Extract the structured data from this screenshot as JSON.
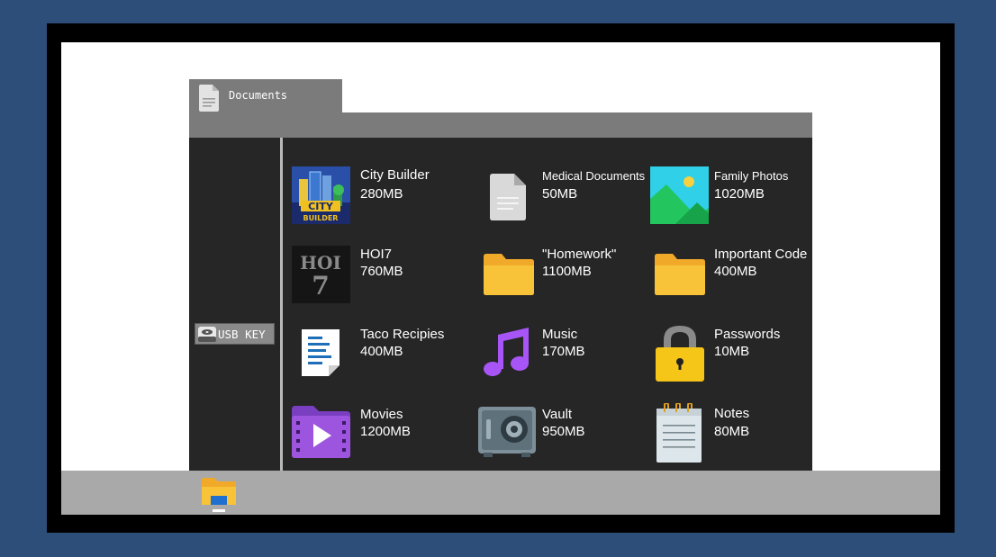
{
  "window": {
    "title": "Documents"
  },
  "sidebar": {
    "usb_label": "USB KEY"
  },
  "files": [
    {
      "name": "City Builder",
      "size": "280MB",
      "icon": "city-builder-icon"
    },
    {
      "name": "Medical Documents",
      "size": "50MB",
      "icon": "document-icon"
    },
    {
      "name": "Family Photos",
      "size": "1020MB",
      "icon": "image-icon"
    },
    {
      "name": "HOI7",
      "size": "760MB",
      "icon": "hoi7-icon"
    },
    {
      "name": "\"Homework\"",
      "size": "1100MB",
      "icon": "folder-icon"
    },
    {
      "name": "Important Code",
      "size": "400MB",
      "icon": "folder-icon"
    },
    {
      "name": "Taco Recipies",
      "size": "400MB",
      "icon": "text-file-icon"
    },
    {
      "name": "Music",
      "size": "170MB",
      "icon": "music-note-icon"
    },
    {
      "name": "Passwords",
      "size": "10MB",
      "icon": "padlock-icon"
    },
    {
      "name": "Movies",
      "size": "1200MB",
      "icon": "video-folder-icon"
    },
    {
      "name": "Vault",
      "size": "950MB",
      "icon": "safe-icon"
    },
    {
      "name": "Notes",
      "size": "80MB",
      "icon": "notepad-icon"
    }
  ],
  "colors": {
    "background": "#2e4e7a",
    "window_bar": "#7b7b7b",
    "window_body": "#262626",
    "taskbar": "#a9a9a9",
    "folder": "#f8c338"
  }
}
